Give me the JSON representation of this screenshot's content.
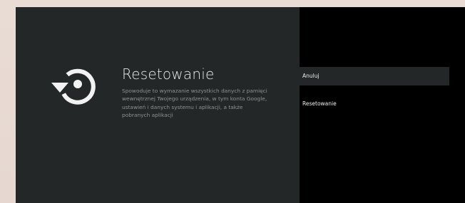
{
  "main": {
    "icon": "reset-restore-icon",
    "title": "Resetowanie",
    "description": "Spowoduje to wymazanie wszystkich danych z pamięci wewnętrznej Twojego urządzenia, w tym konta Google, ustawień i danych systemu i aplikacji, a także pobranych aplikacji"
  },
  "options": [
    {
      "label": "Anuluj",
      "focused": true
    },
    {
      "label": "Resetowanie",
      "focused": false
    }
  ],
  "colors": {
    "panel": "#242728",
    "side_panel": "#000000",
    "title": "#e9eaea",
    "description": "#8e9294"
  }
}
